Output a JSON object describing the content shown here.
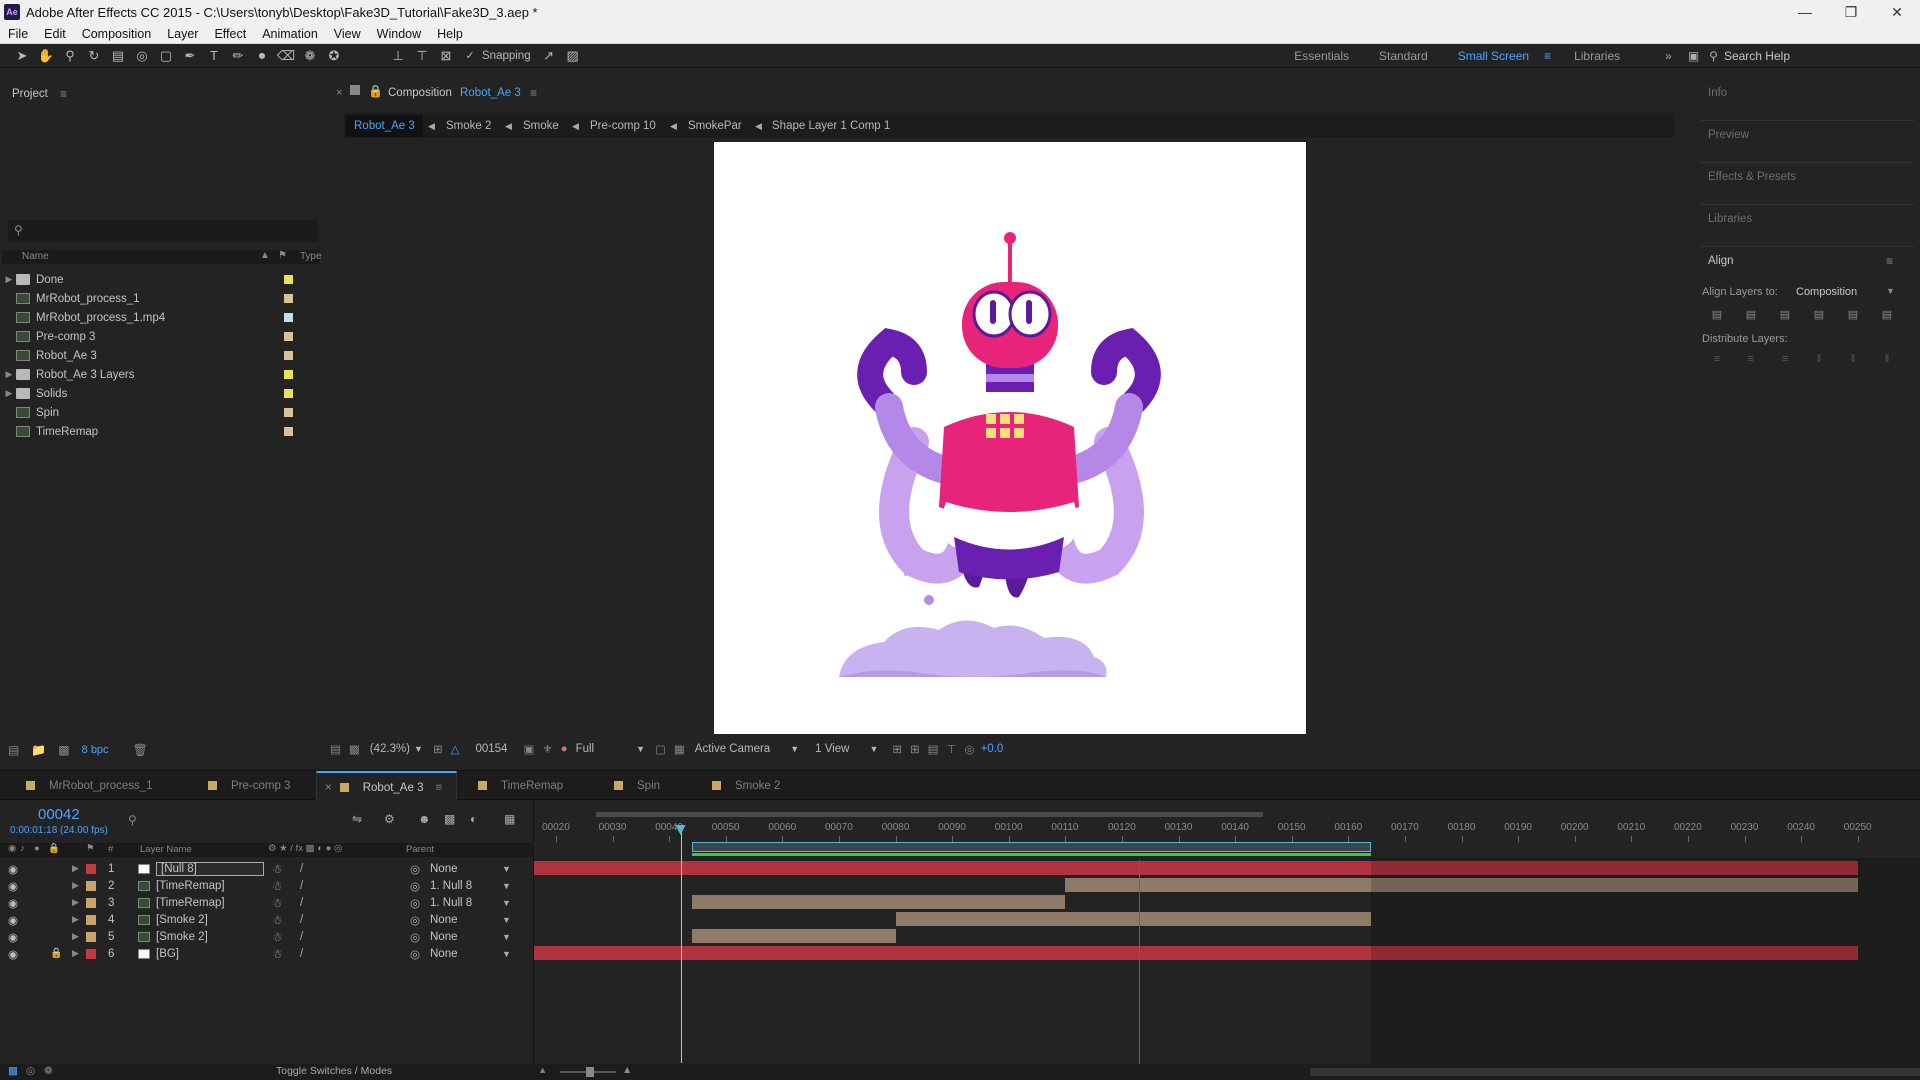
{
  "window": {
    "title": "Adobe After Effects CC 2015 - C:\\Users\\tonyb\\Desktop\\Fake3D_Tutorial\\Fake3D_3.aep *",
    "app_icon": "Ae"
  },
  "menu": [
    "File",
    "Edit",
    "Composition",
    "Layer",
    "Effect",
    "Animation",
    "View",
    "Window",
    "Help"
  ],
  "toolbar": {
    "snapping_label": "Snapping",
    "workspaces": [
      "Essentials",
      "Standard",
      "Small Screen",
      "Libraries"
    ],
    "active_workspace": "Small Screen",
    "search_label": "Search Help"
  },
  "project": {
    "title": "Project",
    "columns": {
      "name": "Name",
      "type": "Type"
    },
    "items": [
      {
        "name": "Done",
        "kind": "folder",
        "expand": "▶",
        "color": "#e6e05a"
      },
      {
        "name": "MrRobot_process_1",
        "kind": "comp",
        "expand": "",
        "color": "#d9c49a"
      },
      {
        "name": "MrRobot_process_1.mp4",
        "kind": "footage",
        "expand": "",
        "color": "#bfe0e8"
      },
      {
        "name": "Pre-comp 3",
        "kind": "comp",
        "expand": "",
        "color": "#d9c49a"
      },
      {
        "name": "Robot_Ae 3",
        "kind": "comp",
        "expand": "",
        "color": "#d9c49a"
      },
      {
        "name": "Robot_Ae 3 Layers",
        "kind": "folder",
        "expand": "▶",
        "color": "#e6e05a"
      },
      {
        "name": "Solids",
        "kind": "folder",
        "expand": "▶",
        "color": "#e6e05a"
      },
      {
        "name": "Spin",
        "kind": "comp",
        "expand": "",
        "color": "#d9c49a"
      },
      {
        "name": "TimeRemap",
        "kind": "comp",
        "expand": "",
        "color": "#d9c49a"
      }
    ],
    "bpc": "8 bpc"
  },
  "viewer": {
    "panel_label": "Composition",
    "comp_name": "Robot_Ae 3",
    "breadcrumbs": [
      "Robot_Ae 3",
      "Smoke 2",
      "Smoke",
      "Pre-comp 10",
      "SmokePar",
      "Shape Layer 1 Comp 1"
    ],
    "zoom": "(42.3%)",
    "frame": "00154",
    "resolution": "Full",
    "camera": "Active Camera",
    "views": "1 View",
    "exposure": "+0.0"
  },
  "right_panels": {
    "items": [
      "Info",
      "Preview",
      "Effects & Presets",
      "Libraries"
    ],
    "align_title": "Align",
    "align_layers_to": "Align Layers to:",
    "align_target": "Composition",
    "distribute_label": "Distribute Layers:"
  },
  "timeline": {
    "tabs": [
      "MrRobot_process_1",
      "Pre-comp 3",
      "Robot_Ae 3",
      "TimeRemap",
      "Spin",
      "Smoke 2"
    ],
    "active_tab": "Robot_Ae 3",
    "current_frame": "00042",
    "timecode": "0:00:01:18 (24.00 fps)",
    "col_layer_name": "Layer Name",
    "col_parent": "Parent",
    "hash": "#",
    "ticks": [
      "00020",
      "00030",
      "00040",
      "00050",
      "00060",
      "00070",
      "00080",
      "00090",
      "00100",
      "00110",
      "00120",
      "00130",
      "00140",
      "00150",
      "00160",
      "00170",
      "00180",
      "00190",
      "00200",
      "00210",
      "00220",
      "00230",
      "00240",
      "00250"
    ],
    "layers": [
      {
        "num": "1",
        "name": "[Null 8]",
        "parent": "None",
        "label": "#c43a3a",
        "swatch": "#ffffff",
        "bar_color": "#b0343f",
        "bar_start": 0,
        "bar_end": 250,
        "selected": true
      },
      {
        "num": "2",
        "name": "[TimeRemap]",
        "parent": "1. Null 8",
        "label": "#c9a36a",
        "swatch": "comp",
        "bar_color": "#8d7b68",
        "bar_start": 110,
        "bar_end": 250,
        "selected": false
      },
      {
        "num": "3",
        "name": "[TimeRemap]",
        "parent": "1. Null 8",
        "label": "#c9a36a",
        "swatch": "comp",
        "bar_color": "#8d7b68",
        "bar_start": 44,
        "bar_end": 110,
        "selected": false
      },
      {
        "num": "4",
        "name": "[Smoke 2]",
        "parent": "None",
        "label": "#c9a36a",
        "swatch": "comp",
        "bar_color": "#8d7b68",
        "bar_start": 80,
        "bar_end": 164,
        "selected": false
      },
      {
        "num": "5",
        "name": "[Smoke 2]",
        "parent": "None",
        "label": "#c9a36a",
        "swatch": "comp",
        "bar_color": "#8d7b68",
        "bar_start": 44,
        "bar_end": 80,
        "selected": false
      },
      {
        "num": "6",
        "name": "[BG]",
        "parent": "None",
        "label": "#c43a3a",
        "swatch": "#ffffff",
        "bar_color": "#b0343f",
        "bar_start": 0,
        "bar_end": 250,
        "selected": false
      }
    ],
    "work_area": {
      "start": 44,
      "end": 164
    },
    "playhead": 42,
    "red_marker": 123,
    "toggle_label": "Toggle Switches / Modes"
  }
}
